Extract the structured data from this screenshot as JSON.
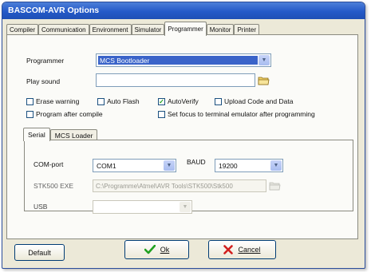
{
  "window": {
    "title": "BASCOM-AVR Options"
  },
  "tabs": [
    "Compiler",
    "Communication",
    "Environment",
    "Simulator",
    "Programmer",
    "Monitor",
    "Printer"
  ],
  "active_tab": "Programmer",
  "programmer": {
    "label": "Programmer",
    "selected": "MCS Bootloader",
    "play_sound_label": "Play sound",
    "play_sound_value": ""
  },
  "options": {
    "erase_warning": {
      "label": "Erase warning",
      "checked": false
    },
    "auto_flash": {
      "label": "Auto Flash",
      "checked": false
    },
    "auto_verify": {
      "label": "AutoVerify",
      "checked": true
    },
    "upload_code_data": {
      "label": "Upload Code and Data",
      "checked": false
    },
    "program_after_compile": {
      "label": "Program after compile",
      "checked": false
    },
    "set_focus": {
      "label": "Set focus to terminal emulator after programming",
      "checked": false
    }
  },
  "subtabs": [
    "Serial",
    "MCS Loader"
  ],
  "active_subtab": "Serial",
  "serial": {
    "com_label": "COM-port",
    "com_value": "COM1",
    "baud_label": "BAUD",
    "baud_value": "19200",
    "stk_label": "STK500 EXE",
    "stk_value": "C:\\Programme\\Atmel\\AVR Tools\\STK500\\Stk500",
    "usb_label": "USB",
    "usb_value": ""
  },
  "buttons": {
    "default": "Default",
    "ok": "Ok",
    "cancel": "Cancel"
  },
  "icons": {
    "check": "check-icon",
    "cross": "cross-icon",
    "folder": "folder-icon",
    "dropdown": "chevron-down-icon"
  },
  "colors": {
    "title_bar": "#2459c8",
    "selection": "#3a63c9",
    "ok_check": "#21a121",
    "cancel_x": "#d11f1f"
  }
}
